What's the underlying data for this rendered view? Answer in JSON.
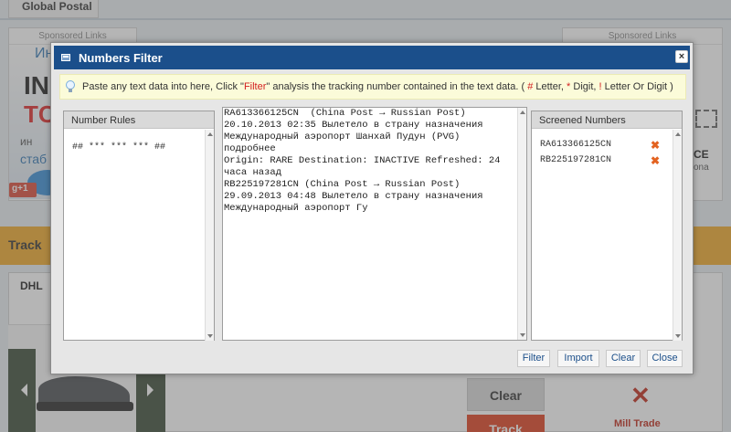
{
  "background": {
    "top_tab": "Global Postal",
    "sponsored_left": "Sponsored Links",
    "sponsored_right": "Sponsored Links",
    "gplus": "g+1",
    "track_bar_text": "Track",
    "dhl_tab": "DHL",
    "clear_button": "Clear",
    "track_button": "Track",
    "mill_label": "Mill Trade"
  },
  "dialog": {
    "title": "Numbers Filter",
    "close_label": "×",
    "tip": {
      "before": "Paste any text data into here, Click \"",
      "filter_word": "Filter",
      "middle": "\" analysis the tracking number contained in the text data. ( ",
      "hash": "#",
      "letter_text": " Letter, ",
      "star": "*",
      "digit_text": " Digit, ",
      "bang": "!",
      "lod_text": " Letter Or Digit )"
    },
    "rules_panel": {
      "header": "Number Rules",
      "rule": "## *** *** *** ##"
    },
    "text_panel": {
      "content": "RA613366125CN  (China Post → Russian Post)\n20.10.2013 02:35 Вылетело в страну назначения\nМеждународный аэропорт Шанхай Пудун (PVG)\nподробнее\nOrigin: RARE Destination: INACTIVE Refreshed: 24 часа назад\nRB225197281CN (China Post → Russian Post)\n29.09.2013 04:48 Вылетело в страну назначения\nМеждународный аэропорт Гу"
    },
    "screened_panel": {
      "header": "Screened Numbers",
      "numbers": [
        "RA613366125CN",
        "RB225197281CN"
      ],
      "remove_glyph": "✖"
    },
    "buttons": {
      "filter": "Filter",
      "import": "Import",
      "clear": "Clear",
      "close": "Close"
    }
  }
}
